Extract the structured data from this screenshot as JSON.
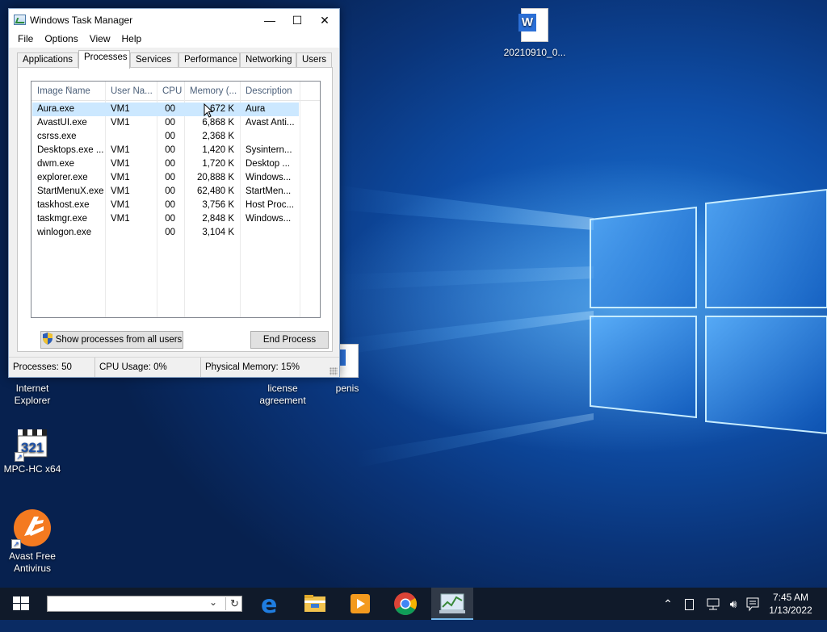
{
  "window": {
    "title": "Windows Task Manager",
    "controls": {
      "minimize": "—",
      "maximize": "☐",
      "close": "✕"
    }
  },
  "menu": [
    "File",
    "Options",
    "View",
    "Help"
  ],
  "tabs": [
    "Applications",
    "Processes",
    "Services",
    "Performance",
    "Networking",
    "Users"
  ],
  "active_tab": "Processes",
  "process_table": {
    "columns": [
      "Image Name",
      "User Na...",
      "CPU",
      "Memory (...",
      "Description"
    ],
    "rows": [
      {
        "image": "Aura.exe",
        "user": "VM1",
        "cpu": "00",
        "memory": "672 K",
        "description": "Aura",
        "selected": true
      },
      {
        "image": "AvastUI.exe",
        "user": "VM1",
        "cpu": "00",
        "memory": "6,868 K",
        "description": "Avast Anti..."
      },
      {
        "image": "csrss.exe",
        "user": "",
        "cpu": "00",
        "memory": "2,368 K",
        "description": ""
      },
      {
        "image": "Desktops.exe ...",
        "user": "VM1",
        "cpu": "00",
        "memory": "1,420 K",
        "description": "Sysintern..."
      },
      {
        "image": "dwm.exe",
        "user": "VM1",
        "cpu": "00",
        "memory": "1,720 K",
        "description": "Desktop ..."
      },
      {
        "image": "explorer.exe",
        "user": "VM1",
        "cpu": "00",
        "memory": "20,888 K",
        "description": "Windows..."
      },
      {
        "image": "StartMenuX.exe",
        "user": "VM1",
        "cpu": "00",
        "memory": "62,480 K",
        "description": "StartMen..."
      },
      {
        "image": "taskhost.exe",
        "user": "VM1",
        "cpu": "00",
        "memory": "3,756 K",
        "description": "Host Proc..."
      },
      {
        "image": "taskmgr.exe",
        "user": "VM1",
        "cpu": "00",
        "memory": "2,848 K",
        "description": "Windows..."
      },
      {
        "image": "winlogon.exe",
        "user": "",
        "cpu": "00",
        "memory": "3,104 K",
        "description": ""
      }
    ]
  },
  "buttons": {
    "show_all": "Show processes from all users",
    "end_process": "End Process"
  },
  "status": {
    "processes": "Processes: 50",
    "cpu": "CPU Usage: 0%",
    "memory": "Physical Memory: 15%"
  },
  "desktop_icons": {
    "word_doc": "20210910_0...",
    "internet_explorer": [
      "Internet",
      "Explorer"
    ],
    "license": [
      "license",
      "agreement"
    ],
    "penis": "penis",
    "mpc": "MPC-HC x64",
    "avast": [
      "Avast Free",
      "Antivirus"
    ]
  },
  "taskbar": {
    "clock_time": "7:45 AM",
    "clock_date": "1/13/2022"
  },
  "colors": {
    "selection": "#cce8ff",
    "header_text": "#4c607a",
    "taskbar": "#101a2a",
    "edge_blue": "#1f7de0",
    "avast_orange": "#f47a20"
  },
  "icons": [
    "word-doc-icon",
    "ie-icon",
    "document-icon",
    "mpc-icon",
    "avast-icon",
    "start-icon",
    "edge-icon",
    "file-explorer-icon",
    "media-player-icon",
    "chrome-icon",
    "task-manager-icon",
    "chevron-up-icon",
    "tablet-icon",
    "network-icon",
    "volume-icon",
    "notification-icon"
  ]
}
